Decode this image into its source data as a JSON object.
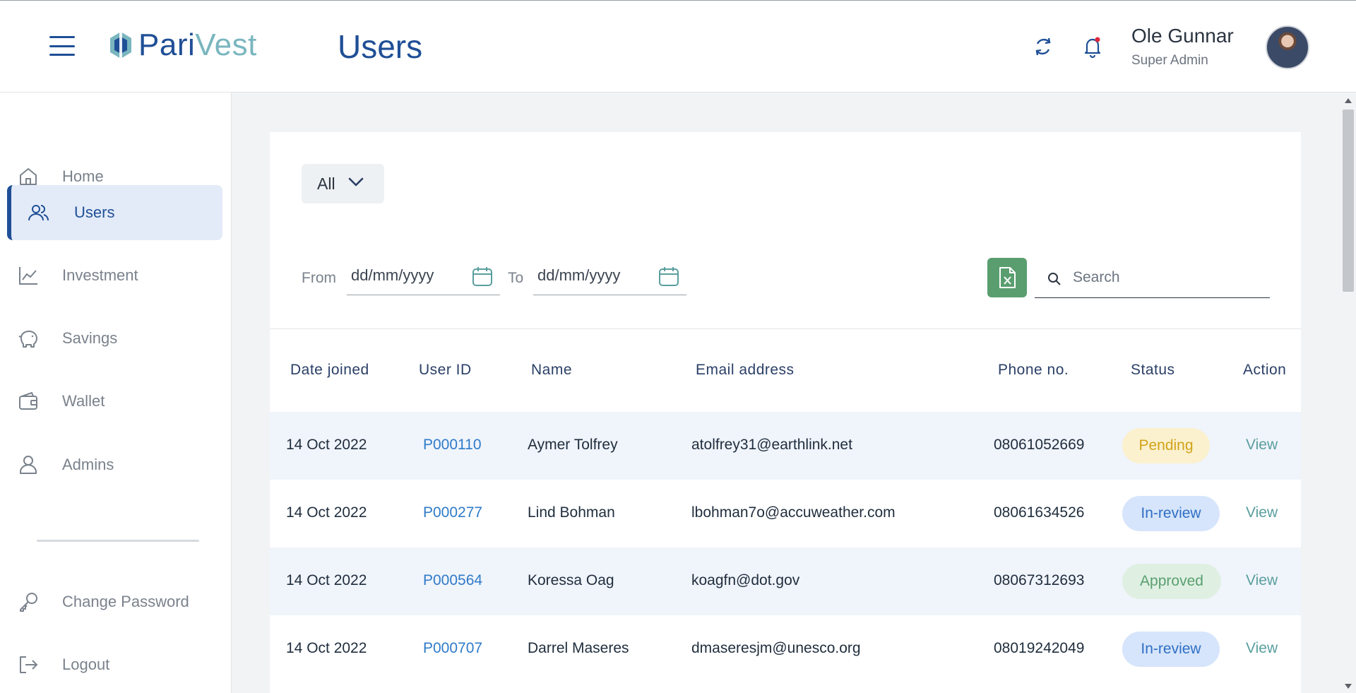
{
  "header": {
    "logo_part1": "Pari",
    "logo_part2": "Vest",
    "page_title": "Users",
    "user_name": "Ole Gunnar",
    "user_role": "Super Admin"
  },
  "sidebar": {
    "items": [
      {
        "label": "Home",
        "icon": "home-icon"
      },
      {
        "label": "Users",
        "icon": "users-icon",
        "active": true
      },
      {
        "label": "Investment",
        "icon": "chart-line-icon"
      },
      {
        "label": "Savings",
        "icon": "piggy-bank-icon"
      },
      {
        "label": "Wallet",
        "icon": "wallet-icon"
      },
      {
        "label": "Admins",
        "icon": "user-icon"
      },
      {
        "label": "Change Password",
        "icon": "key-icon"
      },
      {
        "label": "Logout",
        "icon": "logout-icon"
      }
    ]
  },
  "filters": {
    "status_selected": "All",
    "from_label": "From",
    "from_placeholder": "dd/mm/yyyy",
    "to_label": "To",
    "to_placeholder": "dd/mm/yyyy",
    "search_placeholder": "Search"
  },
  "table": {
    "headers": [
      "Date joined",
      "User ID",
      "Name",
      "Email address",
      "Phone no.",
      "Status",
      "Action"
    ],
    "rows": [
      {
        "date": "14 Oct 2022",
        "user_id": "P000110",
        "name": "Aymer Tolfrey",
        "email": "atolfrey31@earthlink.net",
        "phone": "08061052669",
        "status": "Pending",
        "action": "View"
      },
      {
        "date": "14 Oct 2022",
        "user_id": "P000277",
        "name": "Lind Bohman",
        "email": "lbohman7o@accuweather.com",
        "phone": "08061634526",
        "status": "In-review",
        "action": "View"
      },
      {
        "date": "14 Oct 2022",
        "user_id": "P000564",
        "name": "Koressa Oag",
        "email": "koagfn@dot.gov",
        "phone": "08067312693",
        "status": "Approved",
        "action": "View"
      },
      {
        "date": "14 Oct 2022",
        "user_id": "P000707",
        "name": "Darrel Maseres",
        "email": "dmaseresjm@unesco.org",
        "phone": "08019242049",
        "status": "In-review",
        "action": "View"
      }
    ]
  },
  "colors": {
    "brand_primary": "#1f4f96",
    "brand_secondary": "#7ab6bf",
    "pending": "#d2a318",
    "in_review": "#2f6fc4",
    "approved": "#5a9e6f",
    "excel_button": "#5a9e6f"
  }
}
